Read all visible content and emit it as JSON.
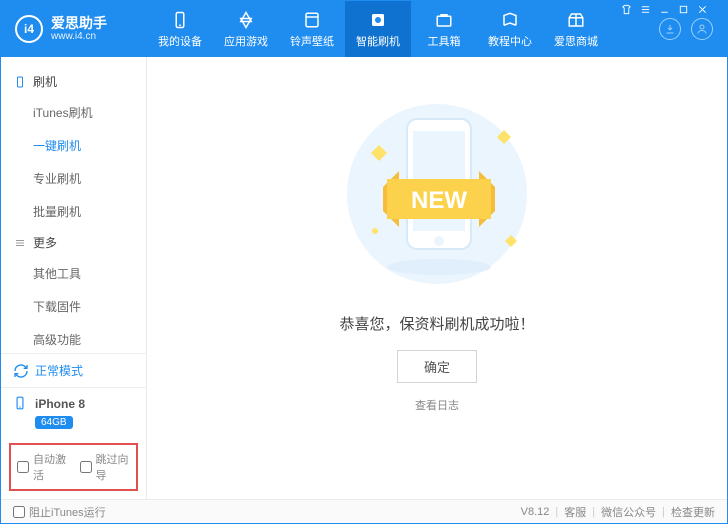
{
  "brand": {
    "name": "爱思助手",
    "site": "www.i4.cn",
    "logo_text": "i4"
  },
  "nav": [
    {
      "label": "我的设备"
    },
    {
      "label": "应用游戏"
    },
    {
      "label": "铃声壁纸"
    },
    {
      "label": "智能刷机",
      "active": true
    },
    {
      "label": "工具箱"
    },
    {
      "label": "教程中心"
    },
    {
      "label": "爱思商城"
    }
  ],
  "sidebar": {
    "groups": [
      {
        "title": "刷机",
        "icon": "phone",
        "items": [
          {
            "label": "iTunes刷机"
          },
          {
            "label": "一键刷机",
            "active": true
          },
          {
            "label": "专业刷机"
          },
          {
            "label": "批量刷机"
          }
        ]
      },
      {
        "title": "更多",
        "icon": "menu",
        "items": [
          {
            "label": "其他工具"
          },
          {
            "label": "下载固件"
          },
          {
            "label": "高级功能"
          }
        ]
      }
    ],
    "status": {
      "label": "正常模式"
    },
    "device": {
      "name": "iPhone 8",
      "storage": "64GB"
    },
    "checks": {
      "auto_activate": "自动激活",
      "skip_guide": "跳过向导"
    }
  },
  "main": {
    "illus_badge": "NEW",
    "message": "恭喜您，保资料刷机成功啦！",
    "ok": "确定",
    "log": "查看日志"
  },
  "footer": {
    "block_itunes": "阻止iTunes运行",
    "version": "V8.12",
    "support": "客服",
    "wechat": "微信公众号",
    "update": "检查更新"
  }
}
